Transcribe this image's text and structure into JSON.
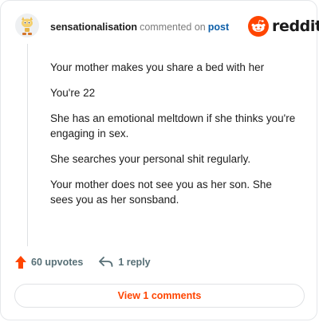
{
  "comment": {
    "username": "sensationalisation",
    "action_text": "commented on",
    "post_link_label": "post",
    "paragraphs": [
      "Your mother makes you share a bed with her",
      "You're 22",
      "She has an emotional meltdown if she thinks you're engaging in sex.",
      "She searches your personal shit regularly.",
      "Your mother does not see you as her son. She sees you as her sonsband."
    ]
  },
  "brand": {
    "logo_text": "reddit",
    "accent_color": "#ff4500"
  },
  "footer": {
    "upvotes_label": "60 upvotes",
    "reply_label": "1 reply",
    "view_comments_label": "View 1 comments"
  },
  "icons": {
    "avatar": "snoo-avatar",
    "logo": "reddit-snoo-icon",
    "upvote": "upvote-arrow-icon",
    "reply": "reply-arrow-icon"
  }
}
